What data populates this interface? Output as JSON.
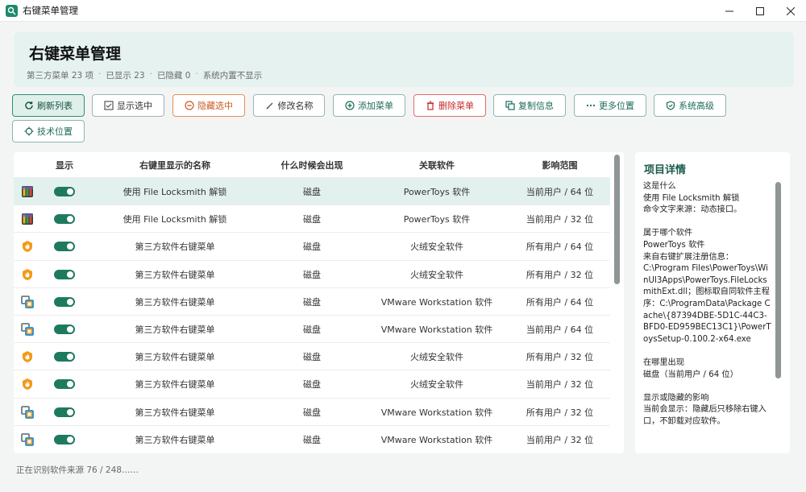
{
  "window": {
    "title": "右键菜单管理"
  },
  "header": {
    "title": "右键菜单管理",
    "stats": [
      "第三方菜单 23 项",
      "已显示 23",
      "已隐藏 0",
      "系统内置不显示"
    ],
    "separator": "·"
  },
  "toolbar": {
    "buttons": [
      {
        "label": "刷新列表",
        "icon": "refresh-icon"
      },
      {
        "label": "显示选中",
        "icon": "checkbox-icon"
      },
      {
        "label": "隐藏选中",
        "icon": "minus-circle-icon"
      },
      {
        "label": "修改名称",
        "icon": "pencil-icon"
      },
      {
        "label": "添加菜单",
        "icon": "plus-circle-icon"
      },
      {
        "label": "删除菜单",
        "icon": "trash-icon"
      },
      {
        "label": "复制信息",
        "icon": "copy-icon"
      },
      {
        "label": "更多位置",
        "icon": "ellipsis-icon"
      },
      {
        "label": "系统高级",
        "icon": "shield-icon"
      },
      {
        "label": "技术位置",
        "icon": "crosshair-icon"
      }
    ]
  },
  "table": {
    "columns": [
      "显示",
      "右键里显示的名称",
      "什么时候会出现",
      "关联软件",
      "影响范围"
    ],
    "rows": [
      {
        "app_icon": "powertoys-icon",
        "name": "使用 File Locksmith 解锁",
        "when": "磁盘",
        "software": "PowerToys 软件",
        "scope": "当前用户 / 64 位",
        "selected": true
      },
      {
        "app_icon": "powertoys-icon",
        "name": "使用 File Locksmith 解锁",
        "when": "磁盘",
        "software": "PowerToys 软件",
        "scope": "当前用户 / 32 位",
        "selected": false
      },
      {
        "app_icon": "huorong-icon",
        "name": "第三方软件右键菜单",
        "when": "磁盘",
        "software": "火绒安全软件",
        "scope": "所有用户 / 64 位",
        "selected": false
      },
      {
        "app_icon": "huorong-icon",
        "name": "第三方软件右键菜单",
        "when": "磁盘",
        "software": "火绒安全软件",
        "scope": "所有用户 / 32 位",
        "selected": false
      },
      {
        "app_icon": "vmware-icon",
        "name": "第三方软件右键菜单",
        "when": "磁盘",
        "software": "VMware Workstation 软件",
        "scope": "所有用户 / 64 位",
        "selected": false
      },
      {
        "app_icon": "vmware-icon",
        "name": "第三方软件右键菜单",
        "when": "磁盘",
        "software": "VMware Workstation 软件",
        "scope": "当前用户 / 64 位",
        "selected": false
      },
      {
        "app_icon": "huorong-icon",
        "name": "第三方软件右键菜单",
        "when": "磁盘",
        "software": "火绒安全软件",
        "scope": "所有用户 / 32 位",
        "selected": false
      },
      {
        "app_icon": "huorong-icon",
        "name": "第三方软件右键菜单",
        "when": "磁盘",
        "software": "火绒安全软件",
        "scope": "当前用户 / 32 位",
        "selected": false
      },
      {
        "app_icon": "vmware-icon",
        "name": "第三方软件右键菜单",
        "when": "磁盘",
        "software": "VMware Workstation 软件",
        "scope": "所有用户 / 32 位",
        "selected": false
      },
      {
        "app_icon": "vmware-icon",
        "name": "第三方软件右键菜单",
        "when": "磁盘",
        "software": "VMware Workstation 软件",
        "scope": "当前用户 / 32 位",
        "selected": false
      }
    ]
  },
  "detail": {
    "title": "项目详情",
    "body": "这是什么\n使用 File Locksmith 解锁\n命令文字来源：动态接口。\n\n属于哪个软件\nPowerToys 软件\n来自右键扩展注册信息：\nC:\\Program Files\\PowerToys\\WinUI3Apps\\PowerToys.FileLocksmithExt.dll；图标取自同软件主程序：C:\\ProgramData\\Package Cache\\{87394DBE-5D1C-44C3-BFD0-ED959BEC13C1}\\PowerToysSetup-0.100.2-x64.exe\n\n在哪里出现\n磁盘（当前用户 / 64 位）\n\n显示或隐藏的影响\n当前会显示：隐藏后只移除右键入口，不卸载对应软件。"
  },
  "status": {
    "text": "正在识别软件来源 76 / 248……"
  },
  "colors": {
    "accent": "#1e7a5f",
    "header_bg": "#e5f2f0",
    "selected_row": "#e3f1ee"
  }
}
